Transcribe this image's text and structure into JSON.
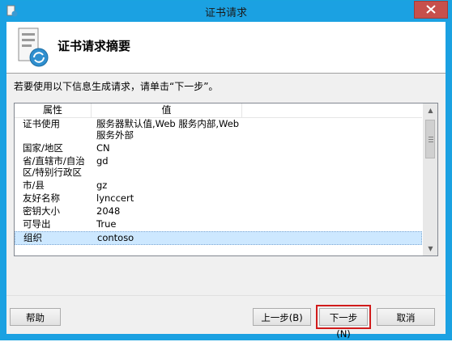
{
  "window": {
    "title": "证书请求"
  },
  "header": {
    "title": "证书请求摘要"
  },
  "instruction": "若要使用以下信息生成请求，请单击“下一步”。",
  "table": {
    "columns": [
      "属性",
      "值"
    ],
    "rows": [
      {
        "property": "证书使用",
        "value": "服务器默认值,Web 服务内部,Web 服务外部"
      },
      {
        "property": "国家/地区",
        "value": "CN"
      },
      {
        "property": "省/直辖市/自治区/特别行政区",
        "value": "gd"
      },
      {
        "property": "市/县",
        "value": "gz"
      },
      {
        "property": "友好名称",
        "value": "lynccert"
      },
      {
        "property": "密钥大小",
        "value": "2048"
      },
      {
        "property": "可导出",
        "value": "True"
      },
      {
        "property": "组织",
        "value": "contoso"
      }
    ]
  },
  "buttons": {
    "help": "帮助",
    "back": "上一步(B)",
    "next": "下一步(N)",
    "cancel": "取消"
  },
  "colors": {
    "titlebar": "#1ba1e2",
    "close": "#c7504c",
    "highlight": "#d11b1b"
  }
}
